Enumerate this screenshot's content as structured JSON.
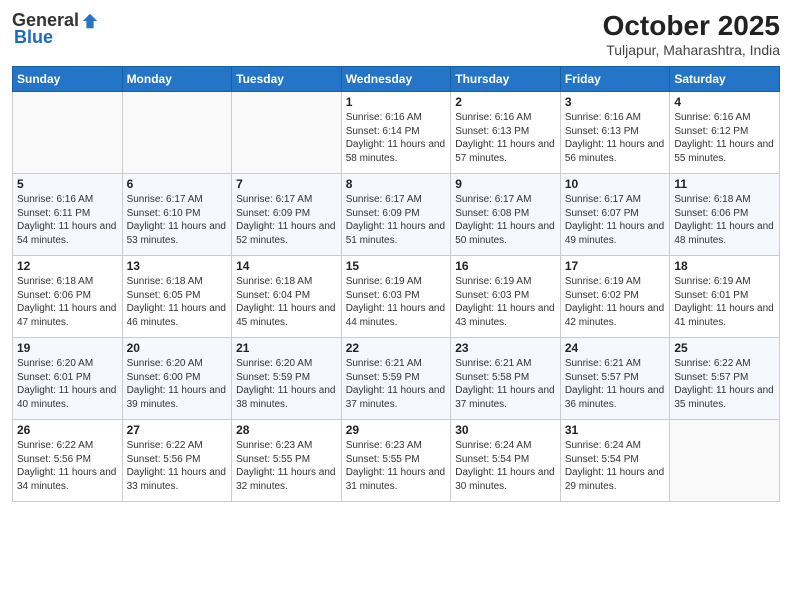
{
  "header": {
    "logo_general": "General",
    "logo_blue": "Blue",
    "title": "October 2025",
    "location": "Tuljapur, Maharashtra, India"
  },
  "days_of_week": [
    "Sunday",
    "Monday",
    "Tuesday",
    "Wednesday",
    "Thursday",
    "Friday",
    "Saturday"
  ],
  "weeks": [
    [
      {
        "day": "",
        "info": ""
      },
      {
        "day": "",
        "info": ""
      },
      {
        "day": "",
        "info": ""
      },
      {
        "day": "1",
        "info": "Sunrise: 6:16 AM\nSunset: 6:14 PM\nDaylight: 11 hours and 58 minutes."
      },
      {
        "day": "2",
        "info": "Sunrise: 6:16 AM\nSunset: 6:13 PM\nDaylight: 11 hours and 57 minutes."
      },
      {
        "day": "3",
        "info": "Sunrise: 6:16 AM\nSunset: 6:13 PM\nDaylight: 11 hours and 56 minutes."
      },
      {
        "day": "4",
        "info": "Sunrise: 6:16 AM\nSunset: 6:12 PM\nDaylight: 11 hours and 55 minutes."
      }
    ],
    [
      {
        "day": "5",
        "info": "Sunrise: 6:16 AM\nSunset: 6:11 PM\nDaylight: 11 hours and 54 minutes."
      },
      {
        "day": "6",
        "info": "Sunrise: 6:17 AM\nSunset: 6:10 PM\nDaylight: 11 hours and 53 minutes."
      },
      {
        "day": "7",
        "info": "Sunrise: 6:17 AM\nSunset: 6:09 PM\nDaylight: 11 hours and 52 minutes."
      },
      {
        "day": "8",
        "info": "Sunrise: 6:17 AM\nSunset: 6:09 PM\nDaylight: 11 hours and 51 minutes."
      },
      {
        "day": "9",
        "info": "Sunrise: 6:17 AM\nSunset: 6:08 PM\nDaylight: 11 hours and 50 minutes."
      },
      {
        "day": "10",
        "info": "Sunrise: 6:17 AM\nSunset: 6:07 PM\nDaylight: 11 hours and 49 minutes."
      },
      {
        "day": "11",
        "info": "Sunrise: 6:18 AM\nSunset: 6:06 PM\nDaylight: 11 hours and 48 minutes."
      }
    ],
    [
      {
        "day": "12",
        "info": "Sunrise: 6:18 AM\nSunset: 6:06 PM\nDaylight: 11 hours and 47 minutes."
      },
      {
        "day": "13",
        "info": "Sunrise: 6:18 AM\nSunset: 6:05 PM\nDaylight: 11 hours and 46 minutes."
      },
      {
        "day": "14",
        "info": "Sunrise: 6:18 AM\nSunset: 6:04 PM\nDaylight: 11 hours and 45 minutes."
      },
      {
        "day": "15",
        "info": "Sunrise: 6:19 AM\nSunset: 6:03 PM\nDaylight: 11 hours and 44 minutes."
      },
      {
        "day": "16",
        "info": "Sunrise: 6:19 AM\nSunset: 6:03 PM\nDaylight: 11 hours and 43 minutes."
      },
      {
        "day": "17",
        "info": "Sunrise: 6:19 AM\nSunset: 6:02 PM\nDaylight: 11 hours and 42 minutes."
      },
      {
        "day": "18",
        "info": "Sunrise: 6:19 AM\nSunset: 6:01 PM\nDaylight: 11 hours and 41 minutes."
      }
    ],
    [
      {
        "day": "19",
        "info": "Sunrise: 6:20 AM\nSunset: 6:01 PM\nDaylight: 11 hours and 40 minutes."
      },
      {
        "day": "20",
        "info": "Sunrise: 6:20 AM\nSunset: 6:00 PM\nDaylight: 11 hours and 39 minutes."
      },
      {
        "day": "21",
        "info": "Sunrise: 6:20 AM\nSunset: 5:59 PM\nDaylight: 11 hours and 38 minutes."
      },
      {
        "day": "22",
        "info": "Sunrise: 6:21 AM\nSunset: 5:59 PM\nDaylight: 11 hours and 37 minutes."
      },
      {
        "day": "23",
        "info": "Sunrise: 6:21 AM\nSunset: 5:58 PM\nDaylight: 11 hours and 37 minutes."
      },
      {
        "day": "24",
        "info": "Sunrise: 6:21 AM\nSunset: 5:57 PM\nDaylight: 11 hours and 36 minutes."
      },
      {
        "day": "25",
        "info": "Sunrise: 6:22 AM\nSunset: 5:57 PM\nDaylight: 11 hours and 35 minutes."
      }
    ],
    [
      {
        "day": "26",
        "info": "Sunrise: 6:22 AM\nSunset: 5:56 PM\nDaylight: 11 hours and 34 minutes."
      },
      {
        "day": "27",
        "info": "Sunrise: 6:22 AM\nSunset: 5:56 PM\nDaylight: 11 hours and 33 minutes."
      },
      {
        "day": "28",
        "info": "Sunrise: 6:23 AM\nSunset: 5:55 PM\nDaylight: 11 hours and 32 minutes."
      },
      {
        "day": "29",
        "info": "Sunrise: 6:23 AM\nSunset: 5:55 PM\nDaylight: 11 hours and 31 minutes."
      },
      {
        "day": "30",
        "info": "Sunrise: 6:24 AM\nSunset: 5:54 PM\nDaylight: 11 hours and 30 minutes."
      },
      {
        "day": "31",
        "info": "Sunrise: 6:24 AM\nSunset: 5:54 PM\nDaylight: 11 hours and 29 minutes."
      },
      {
        "day": "",
        "info": ""
      }
    ]
  ]
}
